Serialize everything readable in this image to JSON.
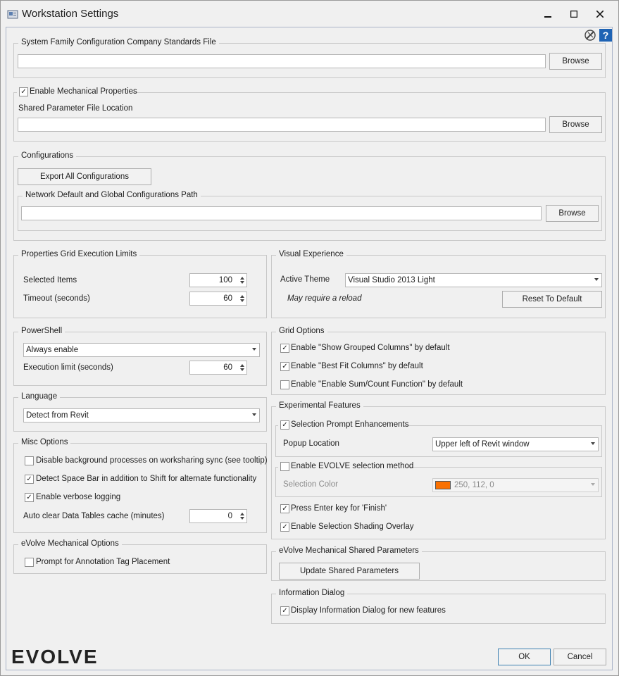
{
  "window": {
    "title": "Workstation Settings"
  },
  "std_file": {
    "legend": "System Family Configuration Company Standards File",
    "value": "",
    "browse": "Browse"
  },
  "mech": {
    "legend": "Enable Mechanical Properties",
    "checked": true,
    "param_label": "Shared Parameter File Location",
    "value": "",
    "browse": "Browse"
  },
  "configs": {
    "legend": "Configurations",
    "export": "Export All Configurations",
    "net_legend": "Network Default and Global Configurations Path",
    "value": "",
    "browse": "Browse"
  },
  "grid_limits": {
    "legend": "Properties Grid Execution Limits",
    "selected_label": "Selected Items",
    "selected_value": "100",
    "timeout_label": "Timeout (seconds)",
    "timeout_value": "60"
  },
  "visual": {
    "legend": "Visual Experience",
    "theme_label": "Active Theme",
    "theme_value": "Visual Studio 2013 Light",
    "note": "May require a reload",
    "reset": "Reset To Default"
  },
  "powershell": {
    "legend": "PowerShell",
    "mode": "Always enable",
    "exec_label": "Execution limit (seconds)",
    "exec_value": "60"
  },
  "grid_options": {
    "legend": "Grid Options",
    "items": [
      {
        "label": "Enable \"Show Grouped Columns\" by default",
        "checked": true
      },
      {
        "label": "Enable \"Best Fit Columns\" by default",
        "checked": true
      },
      {
        "label": "Enable \"Enable Sum/Count Function\" by default",
        "checked": false
      }
    ]
  },
  "language": {
    "legend": "Language",
    "value": "Detect from Revit"
  },
  "experimental": {
    "legend": "Experimental Features",
    "prompt_label": "Selection Prompt Enhancements",
    "prompt_checked": true,
    "popup_label": "Popup Location",
    "popup_value": "Upper left of Revit window",
    "evolve_label": "Enable EVOLVE selection method",
    "evolve_checked": false,
    "color_label": "Selection Color",
    "color_value": "250, 112, 0",
    "color_hex": "#fa7000",
    "enter_label": "Press Enter key for 'Finish'",
    "enter_checked": true,
    "shading_label": "Enable Selection Shading Overlay",
    "shading_checked": true
  },
  "misc": {
    "legend": "Misc Options",
    "items": [
      {
        "label": "Disable background processes on worksharing sync (see tooltip)",
        "checked": false
      },
      {
        "label": "Detect Space Bar in addition to Shift for alternate functionality",
        "checked": true
      },
      {
        "label": "Enable verbose logging",
        "checked": true
      }
    ],
    "cache_label": "Auto clear Data Tables cache (minutes)",
    "cache_value": "0"
  },
  "mech_shared": {
    "legend": "eVolve Mechanical Shared Parameters",
    "button": "Update Shared Parameters"
  },
  "mech_options": {
    "legend": "eVolve Mechanical Options",
    "tag_label": "Prompt for Annotation Tag Placement",
    "tag_checked": false
  },
  "info": {
    "legend": "Information Dialog",
    "label": "Display Information Dialog for new features",
    "checked": true
  },
  "footer": {
    "logo": "EVOLVE",
    "ok": "OK",
    "cancel": "Cancel"
  }
}
